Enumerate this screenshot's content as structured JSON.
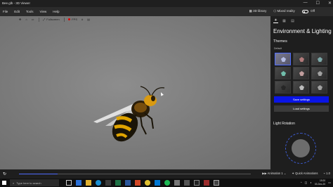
{
  "titlebar": {
    "title": "Bee.glb - 3D Viewer",
    "minimize": "—",
    "maximize": "☐",
    "close": "✕"
  },
  "menu": {
    "items": [
      "File",
      "Edit",
      "Tools",
      "View",
      "Help"
    ]
  },
  "header_right": {
    "library_label": "3D library",
    "mixed_reality_label": "Mixed reality",
    "mixed_reality_state": "Off"
  },
  "viewport_toolbar": {
    "fullscreen_label": "Fullscreen",
    "fps_label": "FPS"
  },
  "panel": {
    "title": "Environment & Lighting",
    "themes_label": "Themes",
    "default_label": "Default",
    "save_button": "Save settings",
    "load_button": "Load settings",
    "light_rotation_label": "Light Rotation"
  },
  "animation": {
    "name": "Animation 1",
    "quick_label": "Quick Animations",
    "speed": "1.0"
  },
  "taskbar": {
    "search_placeholder": "Type here to search",
    "time": "19:20",
    "date": "03-Dec-20"
  },
  "colors": {
    "accent": "#0a14e6",
    "viewport_bg": "#7a7a7a",
    "panel_bg": "#1e1e1e"
  }
}
